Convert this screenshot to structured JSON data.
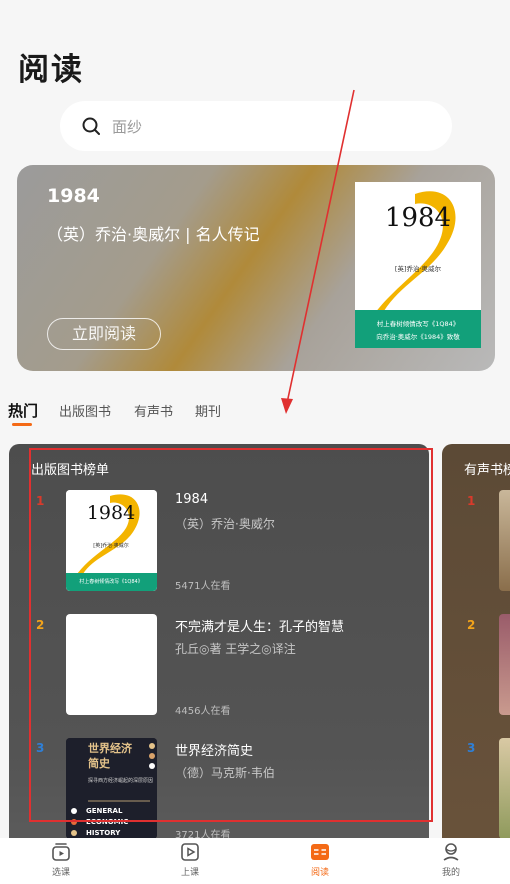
{
  "page": {
    "title": "阅读"
  },
  "search": {
    "placeholder": "面纱"
  },
  "hero": {
    "title": "1984",
    "subtitle": "（英）乔治·奥威尔 | 名人传记",
    "button": "立即阅读"
  },
  "tabs": [
    {
      "label": "热门",
      "active": true
    },
    {
      "label": "出版图书",
      "active": false
    },
    {
      "label": "有声书",
      "active": false
    },
    {
      "label": "期刊",
      "active": false
    }
  ],
  "main_card": {
    "title": "出版图书榜单",
    "items": [
      {
        "rank": "1",
        "rank_color": "#d93a2b",
        "title": "1984",
        "author": "（英）乔治·奥威尔",
        "count": "5471人在看"
      },
      {
        "rank": "2",
        "rank_color": "#f2a31a",
        "title": "不完满才是人生：孔子的智慧",
        "author": "孔丘◎著 王学之◎译注",
        "count": "4456人在看"
      },
      {
        "rank": "3",
        "rank_color": "#2f7fd6",
        "title": "世界经济简史",
        "author": "（德）马克斯·韦伯",
        "count": "3721人在看"
      }
    ]
  },
  "side_card": {
    "title": "有声书榜",
    "ranks": [
      "1",
      "2",
      "3"
    ]
  },
  "covers": {
    "book_1984": {
      "number": "1984",
      "author_line": "[英]乔治·奥威尔",
      "blurb_1": "村上春树倾情改写《1Q84》",
      "blurb_2": "向乔治·奥威尔《1984》致敬",
      "accent": "#f3b400",
      "band": "#12a07a"
    },
    "economy": {
      "title_1": "世界经济",
      "title_2": "简史",
      "tagline": "探寻西方经济崛起的深层原因",
      "en_1": "GENERAL",
      "en_2": "ECONOMIC",
      "en_3": "HISTORY",
      "bg": "#1d1f2b",
      "accent": "#e3c28a"
    }
  },
  "bottom_nav": [
    {
      "label": "选课",
      "icon": "course-icon",
      "active": false
    },
    {
      "label": "上课",
      "icon": "play-icon",
      "active": false
    },
    {
      "label": "阅读",
      "icon": "reading-icon",
      "active": true
    },
    {
      "label": "我的",
      "icon": "profile-icon",
      "active": false
    }
  ],
  "colors": {
    "accent": "#f46a16",
    "annotation": "#e03030"
  }
}
